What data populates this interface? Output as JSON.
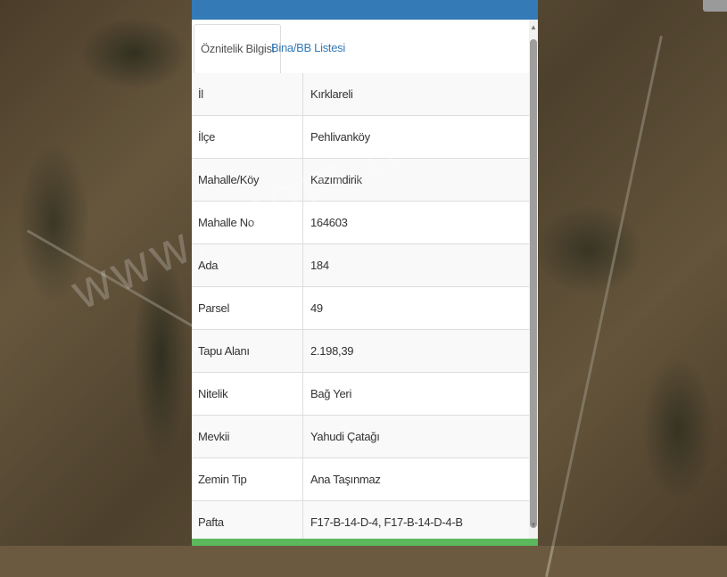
{
  "tabs": [
    {
      "label": "Öznitelik Bilgisi"
    },
    {
      "label": "Bina/BB Listesi"
    }
  ],
  "rows": [
    {
      "key": "İl",
      "value": "Kırklareli"
    },
    {
      "key": "İlçe",
      "value": "Pehlivanköy"
    },
    {
      "key": "Mahalle/Köy",
      "value": "Kazımdirik"
    },
    {
      "key": "Mahalle No",
      "value": "164603"
    },
    {
      "key": "Ada",
      "value": "184"
    },
    {
      "key": "Parsel",
      "value": "49"
    },
    {
      "key": "Tapu Alanı",
      "value": "2.198,39"
    },
    {
      "key": "Nitelik",
      "value": "Bağ Yeri"
    },
    {
      "key": "Mevkii",
      "value": "Yahudi Çatağı"
    },
    {
      "key": "Zemin Tip",
      "value": "Ana Taşınmaz"
    },
    {
      "key": "Pafta",
      "value": "F17-B-14-D-4, F17-B-14-D-4-B"
    }
  ],
  "scroll": {
    "up": "▲",
    "down": "▼"
  },
  "watermark": "www.        .com.tr",
  "colors": {
    "header": "#337ab7",
    "footer": "#5cb85c",
    "link": "#337ab7"
  }
}
